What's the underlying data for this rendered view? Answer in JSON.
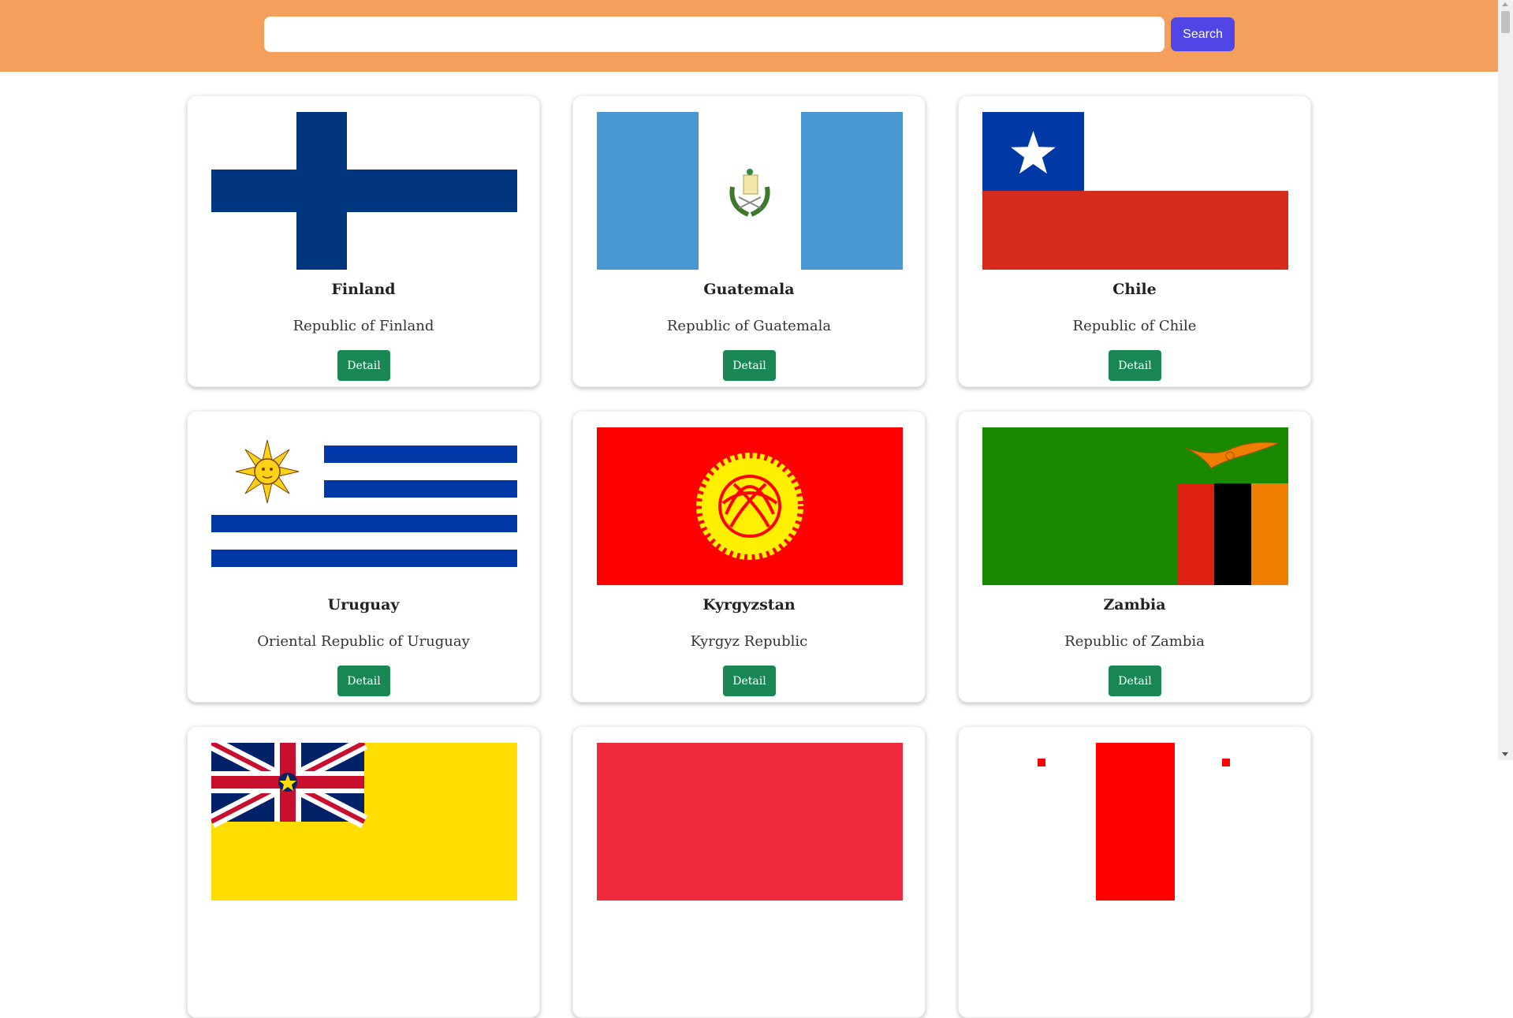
{
  "search": {
    "placeholder": "",
    "value": "",
    "button_label": "Search"
  },
  "countries": [
    {
      "name": "Finland",
      "official": "Republic of Finland",
      "detail_label": "Detail",
      "flag_icon": "finland-flag-icon"
    },
    {
      "name": "Guatemala",
      "official": "Republic of Guatemala",
      "detail_label": "Detail",
      "flag_icon": "guatemala-flag-icon"
    },
    {
      "name": "Chile",
      "official": "Republic of Chile",
      "detail_label": "Detail",
      "flag_icon": "chile-flag-icon"
    },
    {
      "name": "Uruguay",
      "official": "Oriental Republic of Uruguay",
      "detail_label": "Detail",
      "flag_icon": "uruguay-flag-icon"
    },
    {
      "name": "Kyrgyzstan",
      "official": "Kyrgyz Republic",
      "detail_label": "Detail",
      "flag_icon": "kyrgyzstan-flag-icon"
    },
    {
      "name": "Zambia",
      "official": "Republic of Zambia",
      "detail_label": "Detail",
      "flag_icon": "zambia-flag-icon"
    }
  ],
  "colors": {
    "header_bg": "#f4a05c",
    "search_button": "#4f46e5",
    "detail_button": "#198754"
  }
}
